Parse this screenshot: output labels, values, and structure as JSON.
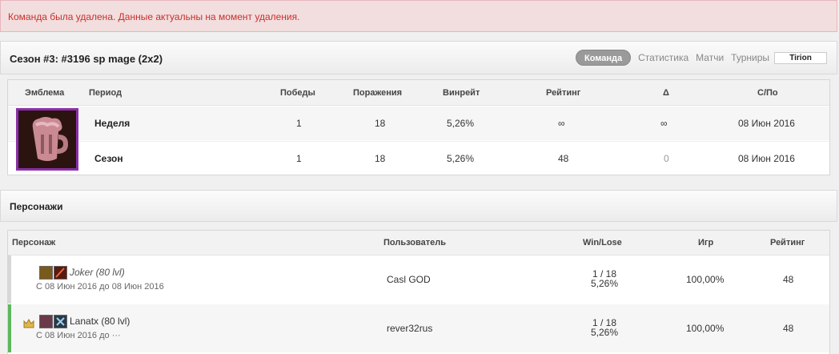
{
  "alert": {
    "text": "Команда была удалена. Данные актуальны на момент удаления."
  },
  "season": {
    "title": "Сезон #3: #3196 sp mage (2x2)",
    "nav": {
      "active": "Команда",
      "stats": "Статистика",
      "matches": "Матчи",
      "tournaments": "Турниры",
      "realm": "Tirion"
    }
  },
  "stats_table": {
    "headers": {
      "emblem": "Эмблема",
      "period": "Период",
      "wins": "Победы",
      "losses": "Поражения",
      "winrate": "Винрейт",
      "rating": "Рейтинг",
      "delta": "Δ",
      "dates": "С/По"
    },
    "rows": [
      {
        "period": "Неделя",
        "wins": "1",
        "losses": "18",
        "winrate": "5,26%",
        "rating": "∞",
        "delta": "∞",
        "dates": "08 Июн 2016"
      },
      {
        "period": "Сезон",
        "wins": "1",
        "losses": "18",
        "winrate": "5,26%",
        "rating": "48",
        "delta": "0",
        "dates": "08 Июн 2016"
      }
    ]
  },
  "characters": {
    "title": "Персонажи",
    "headers": {
      "character": "Персонаж",
      "user": "Пользователь",
      "winlose": "Win/Lose",
      "games": "Игр",
      "rating": "Рейтинг"
    },
    "rows": [
      {
        "name": "Joker (80 lvl)",
        "dates": "С 08 Июн 2016 до 08 Июн 2016",
        "user": "Casl GOD",
        "winlose": "1 / 18",
        "winrate": "5,26%",
        "games": "100,00%",
        "rating": "48",
        "captain": false
      },
      {
        "name": "Lanatx (80 lvl)",
        "dates": "С 08 Июн 2016 до ···",
        "user": "rever32rus",
        "winlose": "1 / 18",
        "winrate": "5,26%",
        "games": "100,00%",
        "rating": "48",
        "captain": true
      }
    ]
  },
  "colors": {
    "alert_text": "#c9302c",
    "alert_bg": "#f2dede",
    "emblem_border": "#8a2fa8",
    "active_row": "#5cb85c"
  }
}
